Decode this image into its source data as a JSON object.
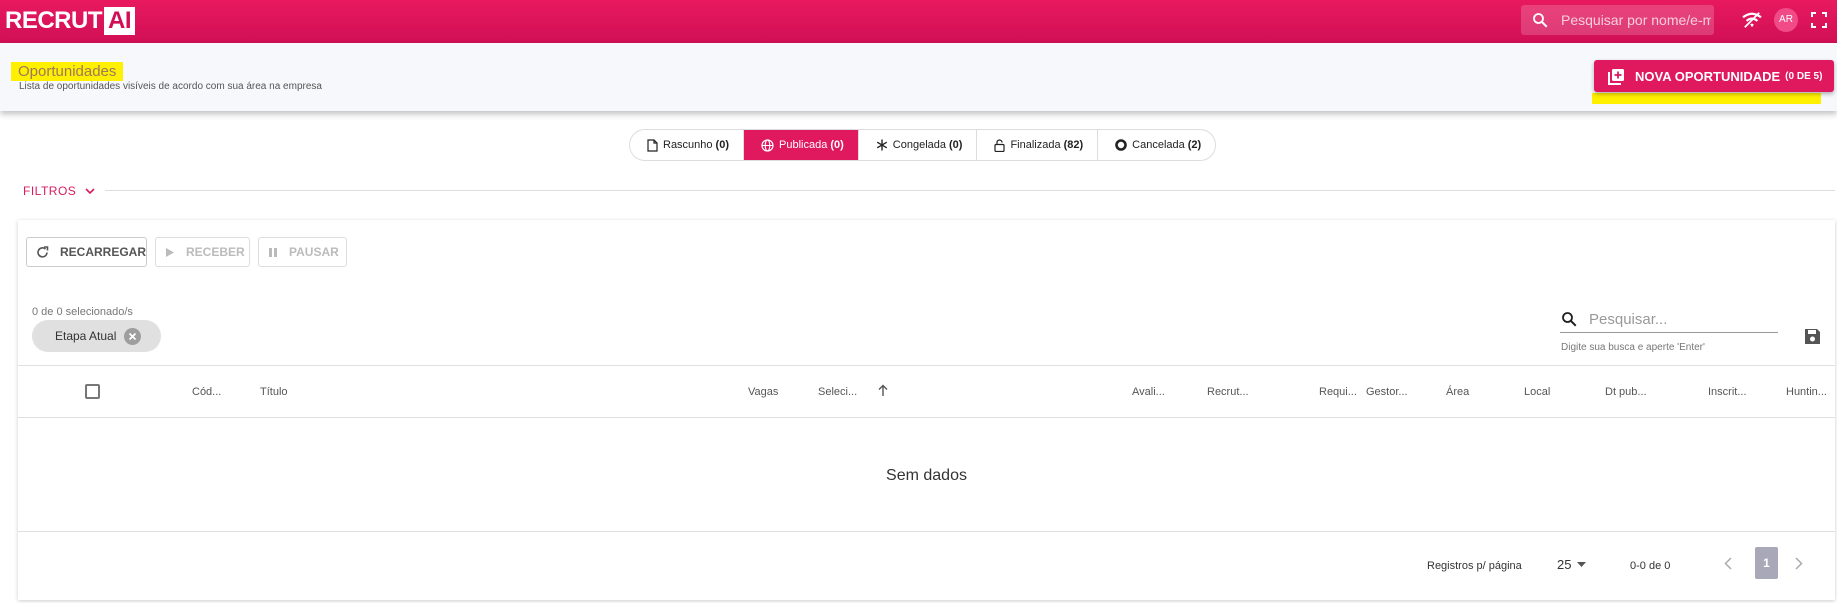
{
  "brand": {
    "logo_main": "RECRUT",
    "logo_ai": "AI",
    "accent": "#e0185d",
    "highlight": "#ffef00"
  },
  "topbar": {
    "search_placeholder": "Pesquisar por nome/e-m",
    "avatar_initials": "AR"
  },
  "header": {
    "title": "Oportunidades",
    "subtitle": "Lista de oportunidades visíveis de acordo com sua área na empresa",
    "new_button": {
      "label": "NOVA OPORTUNIDADE",
      "count": "(0 DE 5)"
    }
  },
  "status_tabs": [
    {
      "label": "Rascunho",
      "count": "(0)",
      "icon": "file-icon",
      "active": false
    },
    {
      "label": "Publicada",
      "count": "(0)",
      "icon": "globe-icon",
      "active": true
    },
    {
      "label": "Congelada",
      "count": "(0)",
      "icon": "snowflake-icon",
      "active": false
    },
    {
      "label": "Finalizada",
      "count": "(82)",
      "icon": "lock-icon",
      "active": false
    },
    {
      "label": "Cancelada",
      "count": "(2)",
      "icon": "circle-icon",
      "active": false
    }
  ],
  "filters": {
    "label": "FILTROS"
  },
  "toolbar": {
    "reload": "RECARREGAR",
    "receive": "RECEBER",
    "pause": "PAUSAR"
  },
  "grid": {
    "selection_count": "0 de 0 selecionado/s",
    "group_chip": "Etapa Atual",
    "search_placeholder": "Pesquisar...",
    "search_hint": "Digite sua busca e aperte 'Enter'",
    "columns": [
      "Cód...",
      "Título",
      "Vagas",
      "Seleci...",
      "Avali...",
      "Recrut...",
      "Requi...",
      "Gestor...",
      "Área",
      "Local",
      "Dt pub...",
      "Inscrit...",
      "Huntin..."
    ],
    "empty_text": "Sem dados",
    "footer": {
      "rows_per_page_label": "Registros p/ página",
      "rows_per_page": "25",
      "range": "0-0 de 0",
      "current_page": "1"
    }
  }
}
